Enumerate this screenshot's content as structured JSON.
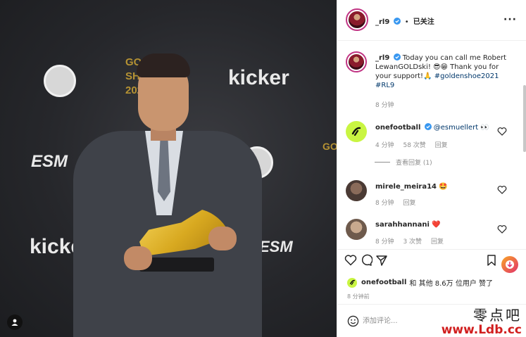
{
  "post": {
    "author": "_rl9",
    "follow_state": "已关注",
    "dot": "•",
    "more": "···"
  },
  "caption": {
    "author": "_rl9",
    "text_1": "Today you can call me Robert LewanGOLDski!",
    "text_2": "😎😁 Thank you for your support!🙏",
    "hashtag_1": "#goldenshoe2021",
    "hashtag_2": "#RL9",
    "time": "8 分钟"
  },
  "comments": [
    {
      "author": "onefootball",
      "text_pre": "",
      "mention": "@esmuellert",
      "emoji": "👀",
      "time": "4 分钟",
      "likes": "58 次赞",
      "reply": "回复",
      "view_replies": "查看回复 (1)"
    },
    {
      "author": "mirele_meira14",
      "emoji": "🤩",
      "time": "8 分钟",
      "reply": "回复"
    },
    {
      "author": "sarahhannani",
      "emoji": "❤️",
      "time": "8 分钟",
      "likes": "3 次赞",
      "reply": "回复"
    }
  ],
  "likes_line": {
    "user": "onefootball",
    "rest": "和 其他 8.6万 位用户 赞了"
  },
  "posted_ago": "8 分钟前",
  "add_comment": {
    "placeholder": "添加评论..."
  },
  "photo": {
    "wall_kicker_1": "kicker",
    "wall_kicker_2": "kicker",
    "wall_esm_1": "ESM",
    "wall_esm_2": "ESM",
    "wall_golden_1": "GOLDEN",
    "wall_golden_2": "SHOE",
    "wall_golden_3": "2021"
  },
  "watermark": {
    "cn": "零点吧",
    "url": "www.Ldb.cc"
  },
  "colors": {
    "verified": "#3897f0",
    "link": "#00376b",
    "muted": "#8e8e8e",
    "onefootball_logo": "#c9f542"
  }
}
